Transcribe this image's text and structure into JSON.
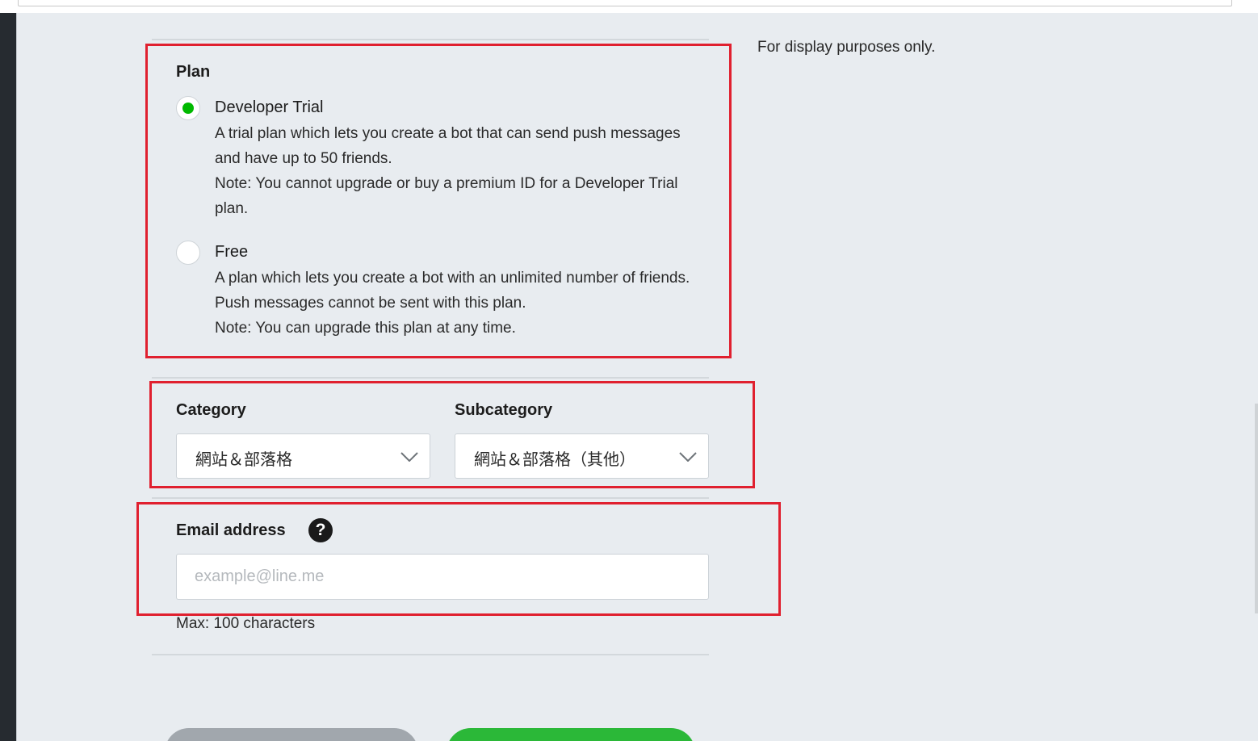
{
  "sidebar_note": "For display purposes only.",
  "plan": {
    "label": "Plan",
    "options": [
      {
        "title": "Developer Trial",
        "selected": true,
        "desc_lines": [
          "A trial plan which lets you create a bot that can send push messages",
          "and have up to 50 friends.",
          "Note: You cannot upgrade or buy a premium ID for a Developer Trial",
          "plan."
        ]
      },
      {
        "title": "Free",
        "selected": false,
        "desc_lines": [
          "A plan which lets you create a bot with an unlimited number of friends.",
          "Push messages cannot be sent with this plan.",
          "Note: You can upgrade this plan at any time."
        ]
      }
    ]
  },
  "category": {
    "label": "Category",
    "value": "網站＆部落格"
  },
  "subcategory": {
    "label": "Subcategory",
    "value": "網站＆部落格（其他）"
  },
  "email": {
    "label": "Email address",
    "help_glyph": "?",
    "placeholder": "example@line.me",
    "value": "",
    "note": "Max: 100 characters"
  },
  "colors": {
    "accent_green": "#00b900",
    "highlight_red": "#e0202f",
    "button_gray": "#a1a7ad",
    "button_green": "#2bb838"
  },
  "icons": {
    "radio_selected": "radio-selected-icon",
    "radio_unselected": "radio-unselected-icon",
    "dropdown": "chevron-down-icon",
    "help": "help-icon"
  }
}
